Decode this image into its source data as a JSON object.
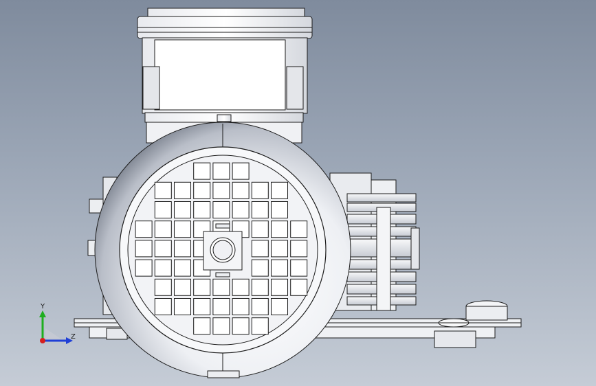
{
  "viewport": {
    "background_top": "#7f8b9d",
    "background_bottom": "#c5ccd6",
    "model_fill": "#f4f5f7",
    "model_stroke": "#1b1b1b",
    "shade_fill": "#c9ccd2"
  },
  "triad": {
    "y_label": "Y",
    "z_label": "Z",
    "y_color": "#1fae1f",
    "z_color": "#1f3fd6",
    "x_color": "#d61f1f"
  }
}
